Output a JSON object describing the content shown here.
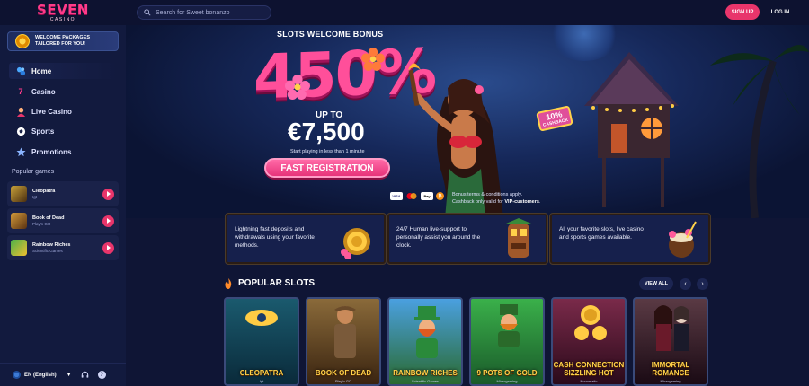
{
  "header": {
    "logo_main": "SEVEN",
    "logo_sub": "CASINO",
    "search_placeholder": "Search for Sweet bonanzo",
    "signup_label": "SIGN UP",
    "login_label": "LOG IN"
  },
  "sidebar": {
    "welcome_line1": "WELCOME PACKAGES",
    "welcome_line2": "TAILORED FOR YOU!",
    "nav": [
      {
        "label": "Home",
        "icon": "home-icon"
      },
      {
        "label": "Casino",
        "icon": "seven-icon"
      },
      {
        "label": "Live Casino",
        "icon": "live-casino-icon"
      },
      {
        "label": "Sports",
        "icon": "soccer-ball-icon"
      },
      {
        "label": "Promotions",
        "icon": "star-icon"
      }
    ],
    "popular_title": "Popular games",
    "games": [
      {
        "name": "Cleopatra",
        "provider": "Igt"
      },
      {
        "name": "Book of Dead",
        "provider": "Play'n GO"
      },
      {
        "name": "Rainbow Riches",
        "provider": "Scientific Games"
      }
    ],
    "language": "EN (English)"
  },
  "hero": {
    "title": "SLOTS WELCOME BONUS",
    "percent": "450%",
    "upto": "UP TO",
    "amount": "€7,500",
    "subtitle": "Start playing in less than 1 minute",
    "cta": "FAST REGISTRATION",
    "cashback_value": "10%",
    "cashback_label": "CASHBACK",
    "payments": [
      "VISA",
      "MC",
      "Pay",
      "₿"
    ],
    "terms_line1": "Bonus terms & conditions apply.",
    "terms_line2_prefix": "Cashback only valid for ",
    "terms_line2_bold": "VIP-customers",
    "terms_line2_suffix": "."
  },
  "features": [
    {
      "text": "Lightning fast deposits and withdrawals using your favorite methods."
    },
    {
      "text": "24/7 Human live-support to personally assist you around the clock."
    },
    {
      "text": "All your favorite slots, live casino and sports games available."
    }
  ],
  "popular_slots": {
    "title": "POPULAR SLOTS",
    "view_all": "VIEW ALL",
    "prev": "‹",
    "next": "›",
    "slots": [
      {
        "name": "CLEOPATRA",
        "provider": "Igt",
        "color": "#0d4a5e"
      },
      {
        "name": "BOOK OF DEAD",
        "provider": "Play'n GO",
        "color": "#6b4a2a"
      },
      {
        "name": "RAINBOW RICHES",
        "provider": "Scientific Games",
        "color": "#2f7fc9"
      },
      {
        "name": "9 POTS OF GOLD",
        "provider": "Microgaming",
        "color": "#2a8a3a"
      },
      {
        "name": "CASH CONNECTION SIZZLING HOT",
        "provider": "Novomatic",
        "color": "#5a1a3a"
      },
      {
        "name": "IMMORTAL ROMANCE",
        "provider": "Microgaming",
        "color": "#3a2430"
      }
    ]
  }
}
